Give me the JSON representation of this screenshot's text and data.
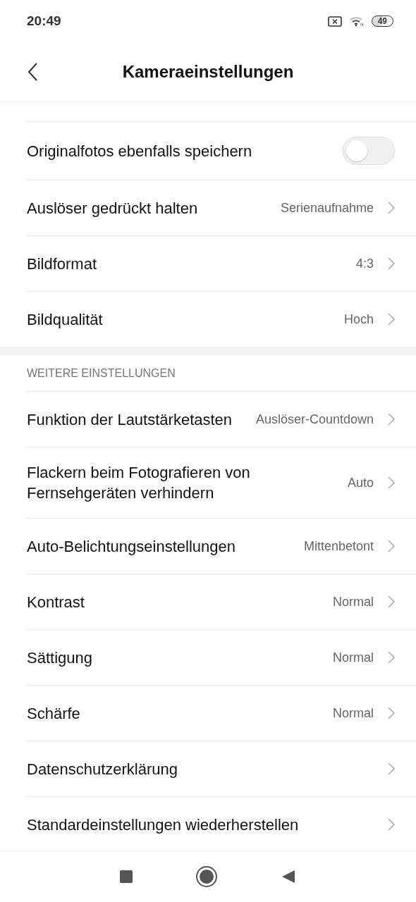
{
  "status_bar": {
    "time": "20:49",
    "battery": "49"
  },
  "header": {
    "title": "Kameraeinstellungen"
  },
  "sections": [
    {
      "items": [
        {
          "kind": "toggle",
          "label": "Originalfotos ebenfalls speichern",
          "on": false
        },
        {
          "kind": "value",
          "label": "Auslöser gedrückt halten",
          "value": "Serienaufnahme"
        },
        {
          "kind": "value",
          "label": "Bildformat",
          "value": "4:3"
        },
        {
          "kind": "value",
          "label": "Bildqualität",
          "value": "Hoch"
        }
      ]
    },
    {
      "heading": "WEITERE EINSTELLUNGEN",
      "items": [
        {
          "kind": "value",
          "label": "Funktion der Lautstärketasten",
          "value": "Auslöser-Countdown"
        },
        {
          "kind": "value",
          "label": "Flackern beim Fotografieren von Fernsehgeräten verhindern",
          "value": "Auto"
        },
        {
          "kind": "value",
          "label": "Auto-Belichtungseinstellungen",
          "value": "Mittenbetont"
        },
        {
          "kind": "value",
          "label": "Kontrast",
          "value": "Normal"
        },
        {
          "kind": "value",
          "label": "Sättigung",
          "value": "Normal"
        },
        {
          "kind": "value",
          "label": "Schärfe",
          "value": "Normal"
        },
        {
          "kind": "link",
          "label": "Datenschutzerklärung"
        },
        {
          "kind": "link",
          "label": "Standardeinstellungen wiederherstellen"
        }
      ]
    }
  ]
}
